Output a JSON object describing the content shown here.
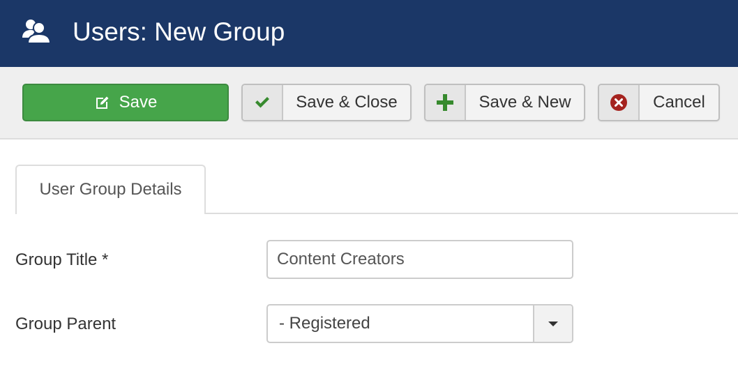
{
  "header": {
    "title": "Users: New Group",
    "icon": "users-icon"
  },
  "toolbar": {
    "save": {
      "label": "Save",
      "icon": "edit-icon"
    },
    "save_close": {
      "label": "Save & Close",
      "icon": "checkmark-icon"
    },
    "save_new": {
      "label": "Save & New",
      "icon": "plus-icon"
    },
    "cancel": {
      "label": "Cancel",
      "icon": "close-circle-icon"
    }
  },
  "colors": {
    "header_bg": "#1b3767",
    "save_green": "#46a54a",
    "check_green": "#378a2e",
    "cancel_red": "#a5231f"
  },
  "tabs": [
    {
      "label": "User Group Details",
      "active": true
    }
  ],
  "form": {
    "group_title": {
      "label": "Group Title *",
      "value": "Content Creators"
    },
    "group_parent": {
      "label": "Group Parent",
      "selected": "- Registered"
    }
  }
}
